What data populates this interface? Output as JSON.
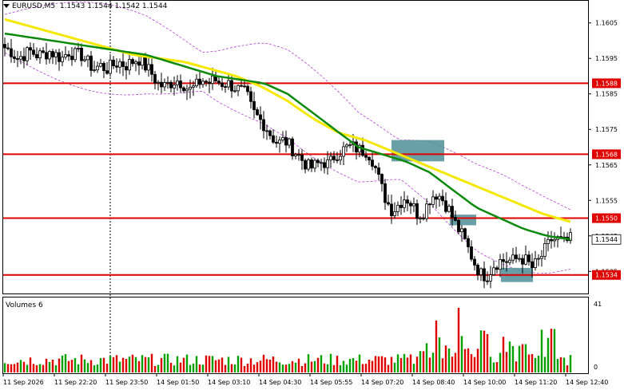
{
  "header": {
    "symbol_timeframe": "EURUSD,M5",
    "ohlc": "1.1543 1.1544 1.1542 1.1544"
  },
  "volume_panel": {
    "title": "Volumes 6",
    "scale_max": "41",
    "scale_min": "0"
  },
  "price_axis": {
    "ticks": [
      "1.1605",
      "1.1595",
      "1.1585",
      "1.1575",
      "1.1565",
      "1.1555",
      "1.1545",
      "1.1535"
    ]
  },
  "time_axis": {
    "labels": [
      "11 Sep 2026",
      "11 Sep 22:20",
      "11 Sep 23:50",
      "14 Sep 01:50",
      "14 Sep 03:10",
      "14 Sep 04:30",
      "14 Sep 05:55",
      "14 Sep 07:20",
      "14 Sep 08:40",
      "14 Sep 10:00",
      "14 Sep 11:20",
      "14 Sep 12:40"
    ]
  },
  "levels": [
    {
      "price": 1.1588,
      "label": "1.1588"
    },
    {
      "price": 1.1568,
      "label": "1.1568"
    },
    {
      "price": 1.155,
      "label": "1.1550"
    },
    {
      "price": 1.1534,
      "label": "1.1534"
    }
  ],
  "current_price": {
    "price": 1.1544,
    "label": "1.1544"
  },
  "colors": {
    "level_line": "#e00000",
    "level_tag": "#e00000",
    "ma_fast": "#0a8a0a",
    "ma_slow": "#f4e800",
    "bollinger": "#b040d0",
    "zone_box": "#4f8f99",
    "volume_up": "#00a000",
    "volume_down": "#e00000",
    "candles": "#000000"
  },
  "chart_data": {
    "type": "candlestick",
    "symbol": "EURUSD",
    "timeframe": "M5",
    "ylim": [
      1.1529,
      1.1611
    ],
    "close_path": [
      1.1598,
      1.1597,
      1.1595,
      1.1596,
      1.1597,
      1.1596,
      1.1596,
      1.1597,
      1.1596,
      1.1595,
      1.1597,
      1.1596,
      1.1596,
      1.1594,
      1.1592,
      1.1593,
      1.1592,
      1.1593,
      1.1594,
      1.1593,
      1.1594,
      1.1595,
      1.1593,
      1.1591,
      1.1588,
      1.1587,
      1.1588,
      1.1589,
      1.1588,
      1.1586,
      1.1587,
      1.1589,
      1.1588,
      1.1589,
      1.1588,
      1.1588,
      1.1587,
      1.1586,
      1.1585,
      1.158,
      1.1578,
      1.1576,
      1.1573,
      1.1571,
      1.1572,
      1.157,
      1.1568,
      1.1566,
      1.1564,
      1.1565,
      1.1566,
      1.1565,
      1.1568,
      1.1569,
      1.157,
      1.157,
      1.1569,
      1.1569,
      1.1566,
      1.156,
      1.1555,
      1.1552,
      1.1554,
      1.1556,
      1.1554,
      1.1551,
      1.1552,
      1.1556,
      1.1557,
      1.1555,
      1.1552,
      1.1548,
      1.1545,
      1.1541,
      1.1537,
      1.1534,
      1.1534,
      1.1537,
      1.1538,
      1.1538,
      1.1538,
      1.1539,
      1.1538,
      1.1536,
      1.1538,
      1.1541,
      1.1544,
      1.1544,
      1.1543,
      1.1544
    ],
    "ma_fast_path": [
      1.1602,
      1.1601,
      1.16,
      1.1599,
      1.1598,
      1.1597,
      1.1596,
      1.1594,
      1.1592,
      1.159,
      1.1589,
      1.1588,
      1.1585,
      1.158,
      1.1575,
      1.157,
      1.1568,
      1.1566,
      1.1563,
      1.1558,
      1.1553,
      1.155,
      1.1547,
      1.1545,
      1.1544
    ],
    "ma_slow_path": [
      1.1606,
      1.1604,
      1.1602,
      1.16,
      1.1598,
      1.1596,
      1.1595,
      1.1594,
      1.1592,
      1.159,
      1.1587,
      1.1583,
      1.1578,
      1.1574,
      1.1572,
      1.1569,
      1.1566,
      1.1563,
      1.156,
      1.1557,
      1.1554,
      1.1551,
      1.1549
    ]
  }
}
